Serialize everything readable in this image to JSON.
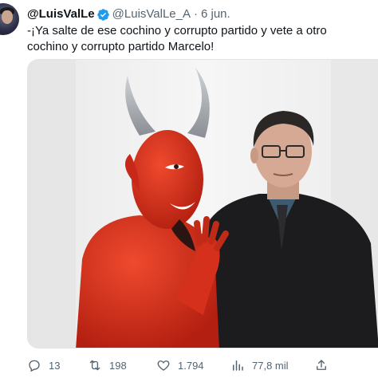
{
  "tweet": {
    "display_name": "@LuisValLe",
    "handle": "@LuisValLe_A",
    "separator": "·",
    "date": "6 jun.",
    "text": "-¡Ya salte de ese cochino y corrupto partido y vete a otro cochino y corrupto partido Marcelo!"
  },
  "media": {
    "description_icon": "photo-meme"
  },
  "actions": {
    "replies": "13",
    "retweets": "198",
    "likes": "1.794",
    "views": "77,8 mil"
  },
  "colors": {
    "text": "#0f1419",
    "secondary": "#536471",
    "verified": "#1d9bf0",
    "devil_red": "#d9311f"
  }
}
